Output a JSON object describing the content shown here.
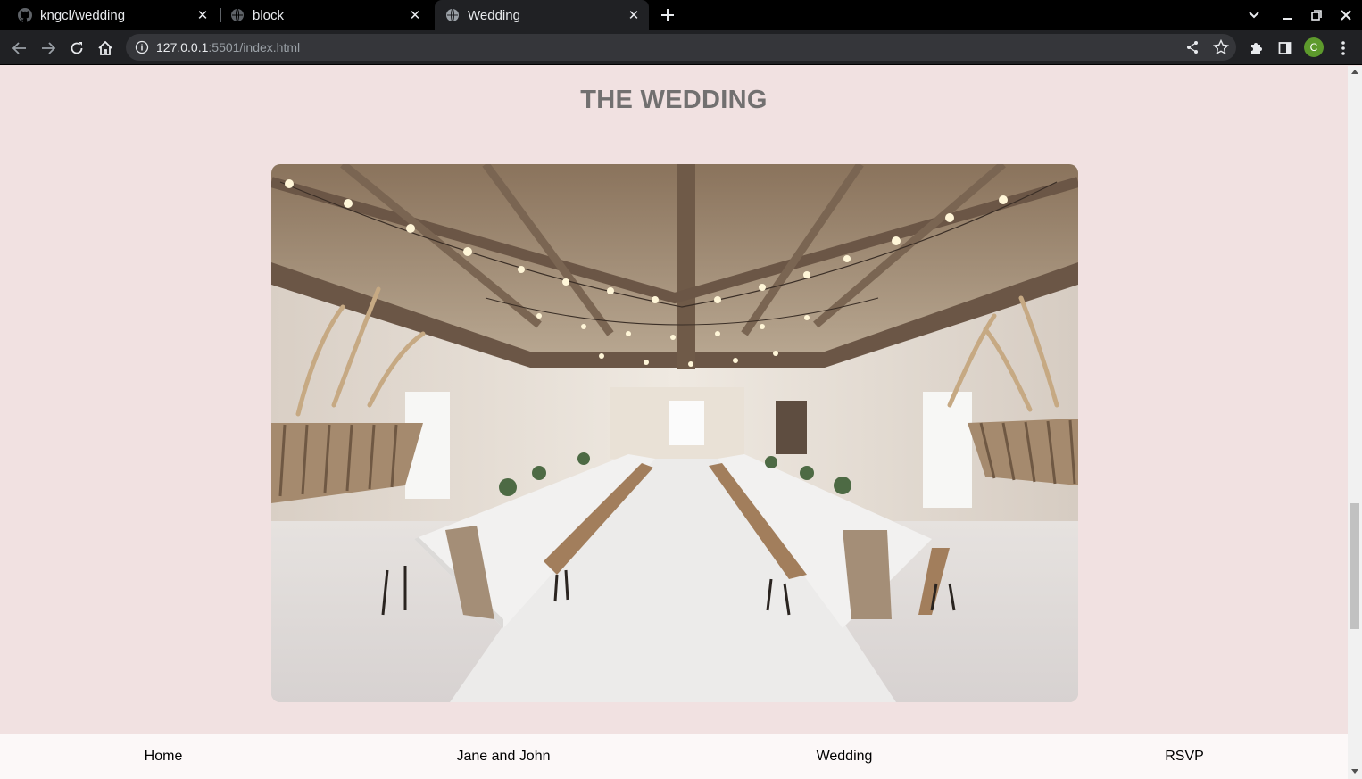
{
  "browser": {
    "tabs": [
      {
        "title": "kngcl/wedding",
        "icon": "github-icon",
        "active": false
      },
      {
        "title": "block",
        "icon": "globe-icon",
        "active": false
      },
      {
        "title": "Wedding",
        "icon": "globe-icon",
        "active": true
      }
    ],
    "close_glyph": "✕",
    "address": {
      "host": "127.0.0.1",
      "rest": ":5501/index.html"
    },
    "profile_initial": "C",
    "profile_color": "#5d9a2c"
  },
  "page": {
    "heading": "THE WEDDING",
    "image_alt": "Wedding reception hall with long tables and string lights",
    "nav": [
      {
        "label": "Home"
      },
      {
        "label": "Jane and John"
      },
      {
        "label": "Wedding"
      },
      {
        "label": "RSVP"
      }
    ],
    "colors": {
      "background": "#f1e1e1",
      "nav_background": "#fcf8f8",
      "heading": "#727070"
    }
  }
}
